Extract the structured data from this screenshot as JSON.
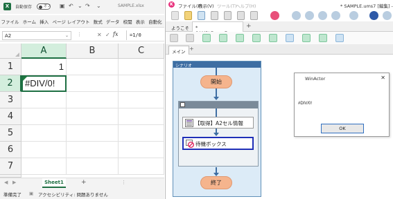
{
  "excel": {
    "autosave_label": "自動保存",
    "autosave_state": "オフ",
    "filename": "SAMPLE.xlsx",
    "menu": [
      "ファイル",
      "ホーム",
      "挿入",
      "ページ レイアウト",
      "数式",
      "データ",
      "校閲",
      "表示",
      "自動化",
      "開発"
    ],
    "name_box": "A2",
    "formula": "=1/0",
    "columns": [
      "A",
      "B",
      "C"
    ],
    "rows": [
      "1",
      "2",
      "3",
      "4",
      "5",
      "6",
      "7",
      "8"
    ],
    "cells": {
      "A1": "1",
      "A2": "#DIV/0!"
    },
    "sheet_tab": "Sheet1",
    "status": {
      "ready": "準備完了",
      "accessibility": "アクセシビリティ: 問題ありません"
    }
  },
  "winactor": {
    "menu": [
      "ファイル(F)",
      "表示(V)",
      "ツール(T)",
      "ヘルプ(H)"
    ],
    "window_title": "* SAMPLE.ums7 [編集] - Win",
    "tabs": [
      "ようこそ",
      "* SAMPLE.ums7"
    ],
    "subtab": "メイン",
    "scenario_label": "シナリオ",
    "start_label": "開始",
    "end_label": "終了",
    "nodes": [
      "【取得】A2セル情報",
      "待機ボックス"
    ],
    "dialog": {
      "title": "WinActor",
      "message": "#DIV/0!",
      "ok_label": "OK"
    },
    "colors": {
      "scenario_header": "#3e6ea3",
      "oval_fill": "#f5b48d",
      "selected_node_border": "#1f2fb8"
    }
  }
}
